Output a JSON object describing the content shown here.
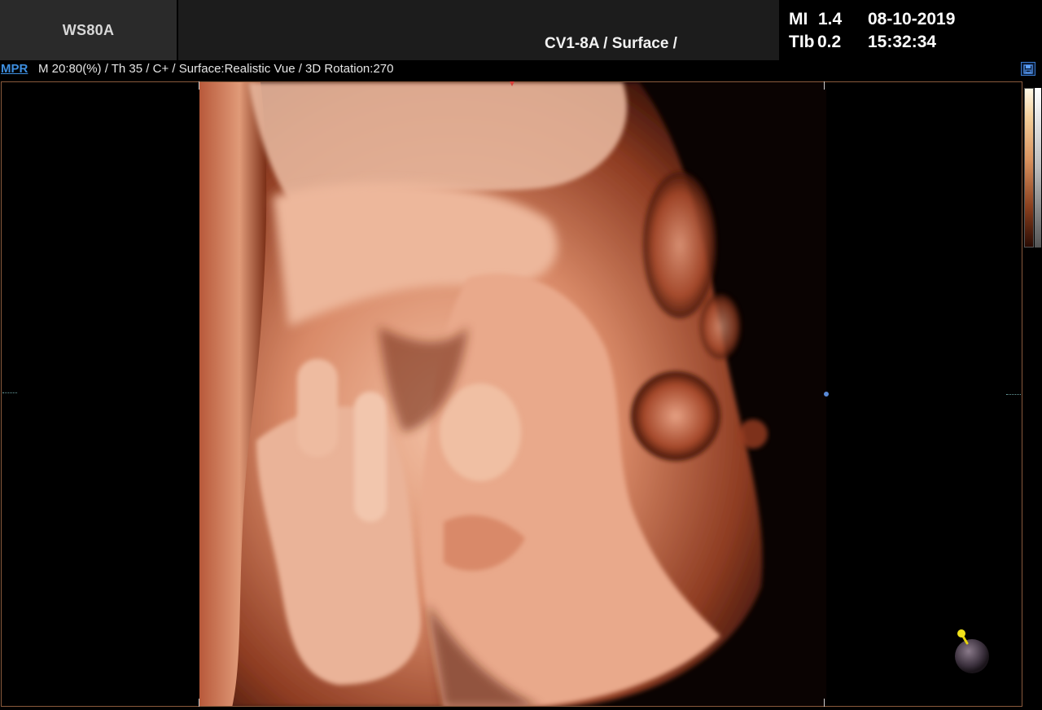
{
  "header": {
    "model": "WS80A",
    "preset": "CV1-8A / Surface /",
    "mi_label": "MI",
    "mi_value": "1.4",
    "tib_label": "TIb",
    "tib_value": "0.2",
    "date": "08-10-2019",
    "time": "15:32:34"
  },
  "status": {
    "mode_link": "MPR",
    "params": "M 20:80(%) / Th 35 / C+ / Surface:Realistic Vue / 3D Rotation:270"
  },
  "colors": {
    "accent_link": "#3e8fe0",
    "viewport_border": "#8a5a3c",
    "skin_tone": "#e8a88a"
  },
  "icons": {
    "save": "save-icon",
    "light": "light-source-icon"
  }
}
